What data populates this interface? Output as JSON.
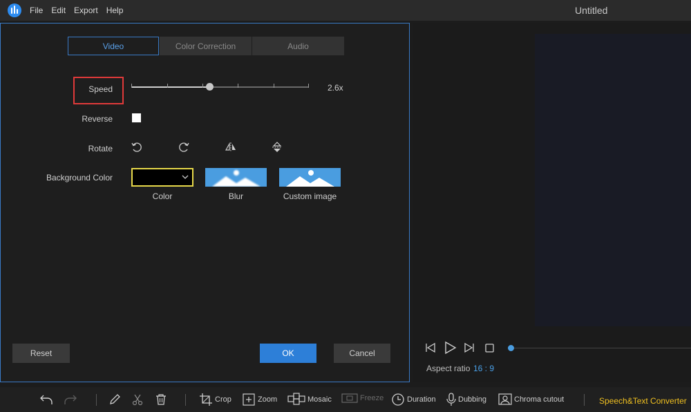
{
  "app": {
    "title": "Untitled",
    "menu": [
      "File",
      "Edit",
      "Export",
      "Help"
    ]
  },
  "dialog": {
    "tabs": [
      {
        "label": "Video",
        "active": true
      },
      {
        "label": "Color Correction",
        "active": false
      },
      {
        "label": "Audio",
        "active": false
      }
    ],
    "speed": {
      "label": "Speed",
      "value_text": "2.6x",
      "slider_fraction": 0.44
    },
    "reverse": {
      "label": "Reverse",
      "checked": false
    },
    "rotate": {
      "label": "Rotate",
      "icons": [
        "rotate-left-icon",
        "rotate-right-icon",
        "flip-horizontal-icon",
        "flip-vertical-icon"
      ]
    },
    "background": {
      "label": "Background Color",
      "options": [
        "Color",
        "Blur",
        "Custom image"
      ],
      "selected_color": "#000000"
    },
    "buttons": {
      "reset": "Reset",
      "ok": "OK",
      "cancel": "Cancel"
    },
    "accent_color": "#2d7fd8"
  },
  "preview": {
    "aspect_label": "Aspect ratio",
    "aspect_value": "16 : 9",
    "playback_icons": [
      "prev-frame-icon",
      "play-icon",
      "next-frame-icon",
      "stop-icon"
    ]
  },
  "toolbar": {
    "crop": "Crop",
    "zoom": "Zoom",
    "mosaic": "Mosaic",
    "freeze": "Freeze",
    "duration": "Duration",
    "dubbing": "Dubbing",
    "chroma": "Chroma cutout",
    "speech": "Speech&Text Converter"
  }
}
